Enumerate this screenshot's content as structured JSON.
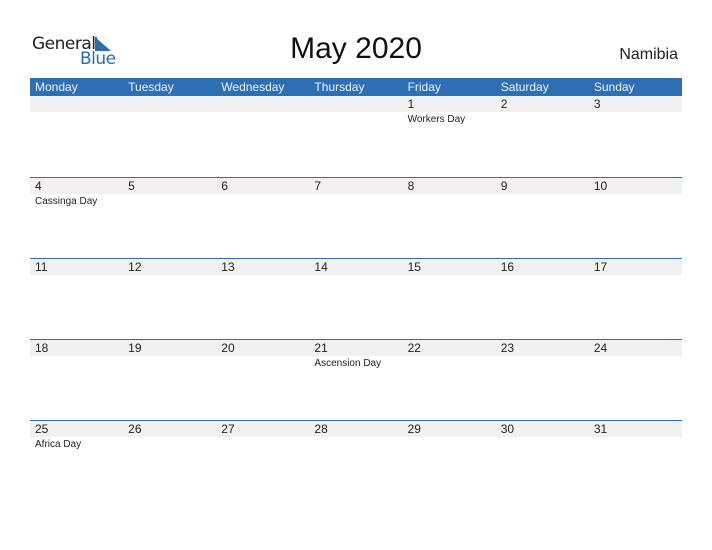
{
  "logo": {
    "line1": "General",
    "line2": "Blue",
    "icon": "triangle-flag-icon"
  },
  "title": "May 2020",
  "country": "Namibia",
  "colors": {
    "header_bg": "#2e6fb4",
    "row_bg": "#f1f1f1",
    "accent": "#2b6cb0"
  },
  "weekdays": [
    "Monday",
    "Tuesday",
    "Wednesday",
    "Thursday",
    "Friday",
    "Saturday",
    "Sunday"
  ],
  "weeks": [
    [
      {
        "day": "",
        "holiday": ""
      },
      {
        "day": "",
        "holiday": ""
      },
      {
        "day": "",
        "holiday": ""
      },
      {
        "day": "",
        "holiday": ""
      },
      {
        "day": "1",
        "holiday": "Workers Day"
      },
      {
        "day": "2",
        "holiday": ""
      },
      {
        "day": "3",
        "holiday": ""
      }
    ],
    [
      {
        "day": "4",
        "holiday": "Cassinga Day"
      },
      {
        "day": "5",
        "holiday": ""
      },
      {
        "day": "6",
        "holiday": ""
      },
      {
        "day": "7",
        "holiday": ""
      },
      {
        "day": "8",
        "holiday": ""
      },
      {
        "day": "9",
        "holiday": ""
      },
      {
        "day": "10",
        "holiday": ""
      }
    ],
    [
      {
        "day": "11",
        "holiday": ""
      },
      {
        "day": "12",
        "holiday": ""
      },
      {
        "day": "13",
        "holiday": ""
      },
      {
        "day": "14",
        "holiday": ""
      },
      {
        "day": "15",
        "holiday": ""
      },
      {
        "day": "16",
        "holiday": ""
      },
      {
        "day": "17",
        "holiday": ""
      }
    ],
    [
      {
        "day": "18",
        "holiday": ""
      },
      {
        "day": "19",
        "holiday": ""
      },
      {
        "day": "20",
        "holiday": ""
      },
      {
        "day": "21",
        "holiday": "Ascension Day"
      },
      {
        "day": "22",
        "holiday": ""
      },
      {
        "day": "23",
        "holiday": ""
      },
      {
        "day": "24",
        "holiday": ""
      }
    ],
    [
      {
        "day": "25",
        "holiday": "Africa Day"
      },
      {
        "day": "26",
        "holiday": ""
      },
      {
        "day": "27",
        "holiday": ""
      },
      {
        "day": "28",
        "holiday": ""
      },
      {
        "day": "29",
        "holiday": ""
      },
      {
        "day": "30",
        "holiday": ""
      },
      {
        "day": "31",
        "holiday": ""
      }
    ]
  ]
}
